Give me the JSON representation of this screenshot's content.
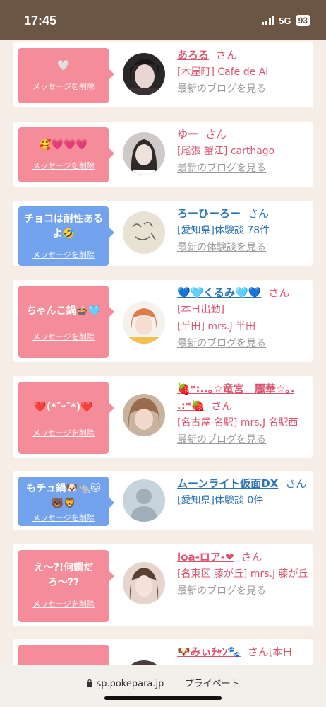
{
  "status": {
    "time": "17:45",
    "network": "5G",
    "battery": "93"
  },
  "common": {
    "delete_label": "メッセージを削除",
    "san": "さん",
    "blog_link": "最新のブログを見る"
  },
  "cards": [
    {
      "message": "🤍",
      "name": "あろる",
      "details": [
        "[木屋町] Cafe de Ai"
      ],
      "link": "最新のブログを見る"
    },
    {
      "message": "🥰💗💗💗",
      "name": "ゆー",
      "details": [
        "[尾張 蟹江] carthago"
      ],
      "link": "最新のブログを見る"
    },
    {
      "message": "チョコは耐性あるよ🤣",
      "name": "ろーひーろー",
      "details": [
        "[愛知県]体験談 78件"
      ],
      "link": "最新の体験談を見る"
    },
    {
      "message": "ちゃんこ鍋🍲🩵",
      "name": "💙🩵くるみ🩵💙",
      "details": [
        "[本日出勤]",
        "[半田] mrs.J 半田"
      ],
      "link": "最新のブログを見る"
    },
    {
      "message": "❤️(*¯ᵕ¯*)❤️",
      "name": "🍓*:..｡☆竜宮　麗華☆｡. .:*🍓",
      "details": [
        "[名古屋 名駅] mrs.J 名駅西"
      ],
      "link": "最新のブログを見る"
    },
    {
      "message": "もチュ鍋🐶🐀🐱🐻🦁",
      "name": "ムーンライト仮面DX",
      "details": [
        "[愛知県]体験談 0件"
      ],
      "link": ""
    },
    {
      "message": "え〜?!何鍋だろ〜??",
      "name": "loa-ロア-❤",
      "details": [
        "[名東区 藤が丘] mrs.J 藤が丘"
      ],
      "link": "最新のブログを見る"
    },
    {
      "message": "",
      "name": "🐶みぃﾁｬﾝ🐾",
      "details": [
        "[本日"
      ],
      "link": ""
    }
  ],
  "browser": {
    "url": "sp.pokepara.jp",
    "separator": "—",
    "mode": "プライベート"
  },
  "colors": {
    "pink_bubble": "#f48c9a",
    "blue_bubble": "#72a3ec",
    "name_pink": "#d9556e",
    "name_blue": "#2c74b3",
    "status_bg": "#6b5646"
  }
}
